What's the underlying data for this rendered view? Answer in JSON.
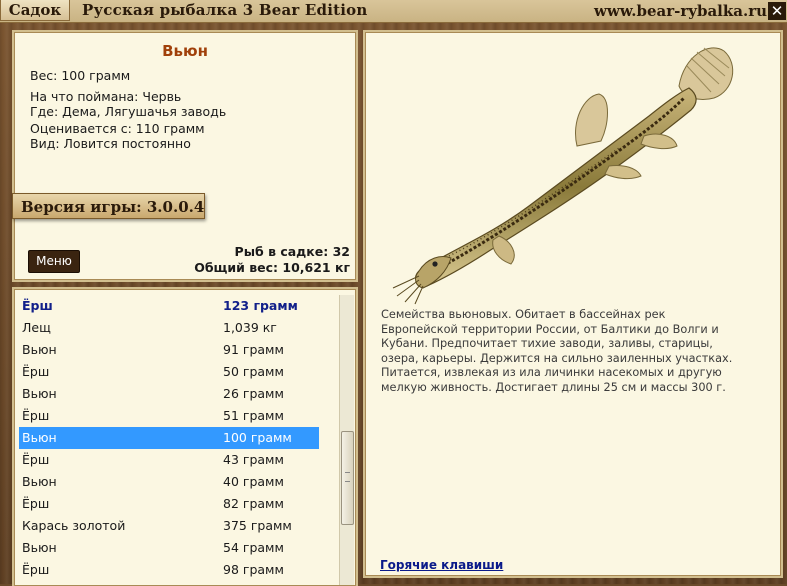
{
  "topbar": {
    "tab": "Садок",
    "title": "Русская рыбалка 3 Bear Edition",
    "url": "www.bear-rybalka.ru",
    "close": "✕"
  },
  "info": {
    "fish_name": "Вьюн",
    "weight": "Вес: 100 грамм",
    "bait": "На что поймана: Червь",
    "location": "Где: Дема, Лягушачья заводь",
    "valued_from": "Оценивается с: 110 грамм",
    "kind": "Вид: Ловится постоянно",
    "version": "Версия игры: 3.0.0.4",
    "menu_label": "Меню",
    "fish_count": "Рыб в садке: 32",
    "total_weight": "Общий вес: 10,621 кг"
  },
  "list": {
    "rows": [
      {
        "name": "Ёрш",
        "weight": "123 грамм",
        "state": "header"
      },
      {
        "name": "Лещ",
        "weight": "1,039 кг",
        "state": ""
      },
      {
        "name": "Вьюн",
        "weight": "91 грамм",
        "state": ""
      },
      {
        "name": "Ёрш",
        "weight": "50 грамм",
        "state": ""
      },
      {
        "name": "Вьюн",
        "weight": "26 грамм",
        "state": ""
      },
      {
        "name": "Ёрш",
        "weight": "51 грамм",
        "state": ""
      },
      {
        "name": "Вьюн",
        "weight": "100 грамм",
        "state": "selected"
      },
      {
        "name": "Ёрш",
        "weight": "43 грамм",
        "state": ""
      },
      {
        "name": "Вьюн",
        "weight": "40 грамм",
        "state": ""
      },
      {
        "name": "Ёрш",
        "weight": "82 грамм",
        "state": ""
      },
      {
        "name": "Карась золотой",
        "weight": "375 грамм",
        "state": ""
      },
      {
        "name": "Вьюн",
        "weight": "54 грамм",
        "state": ""
      },
      {
        "name": "Ёрш",
        "weight": "98 грамм",
        "state": ""
      }
    ]
  },
  "description": {
    "text": "Семейства вьюновых. Обитает в бассейнах рек Европейской территории России, от Балтики до Волги и Кубани. Предпочитает тихие заводи, заливы, старицы, озера, карьеры. Держится на сильно заиленных участках. Питается, извлекая из ила личинки насекомых и другую мелкую живность. Достигает длины 25 см и массы 300 г.",
    "hotkeys_link": "Горячие клавиши",
    "illustration": "loach-fish-illustration"
  },
  "colors": {
    "selected_row": "#3399ff",
    "header_row_text": "#12208a",
    "fish_name": "#a0400a",
    "link": "#0a1a8a"
  }
}
